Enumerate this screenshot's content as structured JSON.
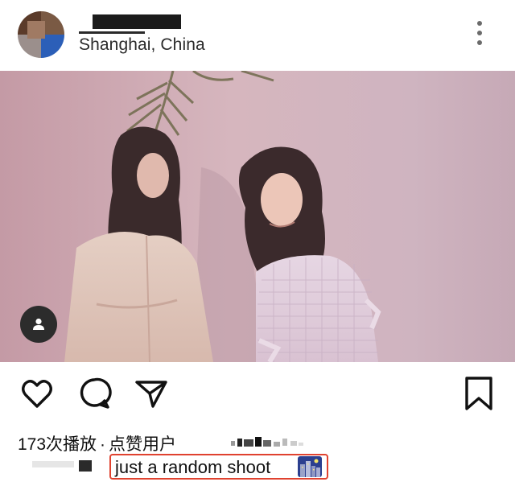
{
  "post": {
    "location": "Shanghai, China",
    "views_count": "173次播放",
    "separator": "·",
    "liked_by_label": "点赞用户",
    "caption": "just a random shoot"
  },
  "icons": {
    "more": "more-vertical-icon",
    "user_tag": "user-tag-icon",
    "like": "heart-icon",
    "comment": "comment-icon",
    "share": "send-icon",
    "save": "bookmark-icon",
    "caption_emoji": "night-city-emoji"
  },
  "colors": {
    "caption_highlight": "#e0422f",
    "text": "#111111",
    "icon": "#111111"
  }
}
